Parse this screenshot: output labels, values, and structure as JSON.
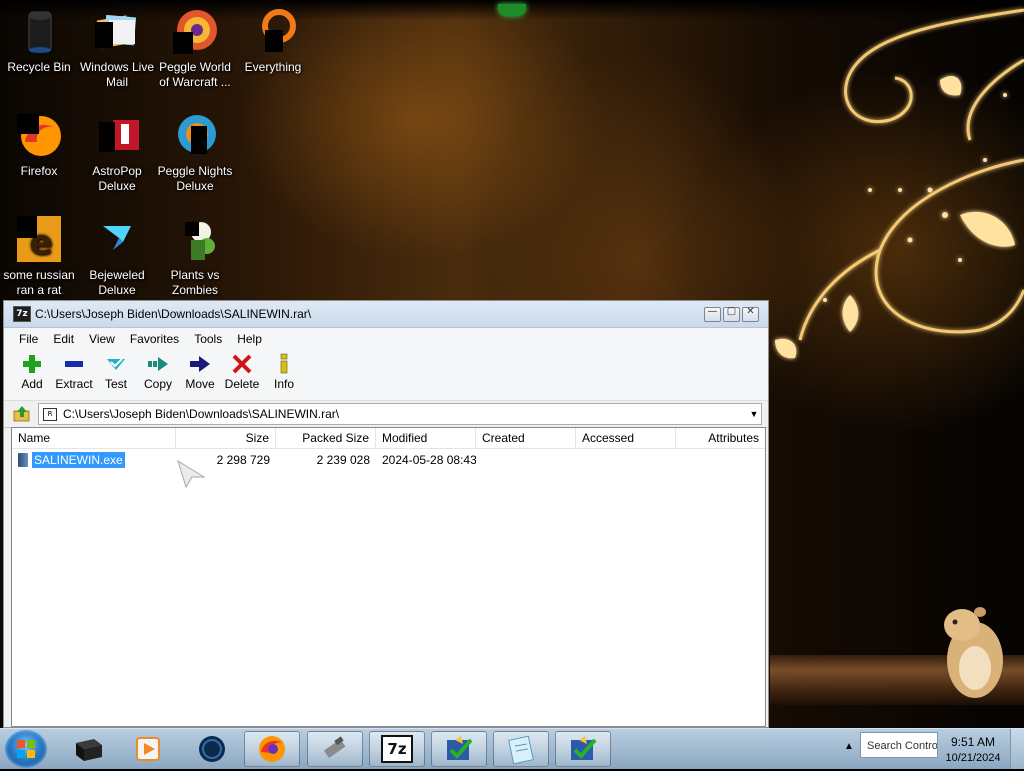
{
  "desktop": {
    "icons": [
      {
        "label": "Recycle Bin",
        "icon": "recycle-bin-icon"
      },
      {
        "label": "Windows Live Mail",
        "icon": "windows-live-mail-icon"
      },
      {
        "label": "Peggle World of Warcraft ...",
        "icon": "peggle-wow-icon"
      },
      {
        "label": "Everything",
        "icon": "everything-search-icon"
      },
      {
        "label": "Firefox",
        "icon": "firefox-icon"
      },
      {
        "label": "AstroPop Deluxe",
        "icon": "astropop-icon"
      },
      {
        "label": "Peggle Nights Deluxe",
        "icon": "peggle-nights-icon"
      },
      {
        "label": "some russian ran a rat",
        "icon": "internet-explorer-shortcut-icon"
      },
      {
        "label": "Bejeweled Deluxe",
        "icon": "bejeweled-icon"
      },
      {
        "label": "Plants vs Zombies",
        "icon": "plants-vs-zombies-icon"
      }
    ]
  },
  "window": {
    "title": "C:\\Users\\Joseph Biden\\Downloads\\SALINEWIN.rar\\",
    "app_icon_text": "7z",
    "controls": {
      "minimize": "—",
      "maximize": "▢",
      "close": "✕"
    },
    "menu": [
      "File",
      "Edit",
      "View",
      "Favorites",
      "Tools",
      "Help"
    ],
    "toolbar": [
      {
        "label": "Add",
        "icon": "add-icon",
        "color": "#1fa31f"
      },
      {
        "label": "Extract",
        "icon": "extract-icon",
        "color": "#1a2bb0"
      },
      {
        "label": "Test",
        "icon": "test-icon",
        "color": "#21b2c8"
      },
      {
        "label": "Copy",
        "icon": "copy-icon",
        "color": "#1b8b7b"
      },
      {
        "label": "Move",
        "icon": "move-icon",
        "color": "#1a1a7a"
      },
      {
        "label": "Delete",
        "icon": "delete-icon",
        "color": "#d21414"
      },
      {
        "label": "Info",
        "icon": "info-icon",
        "color": "#d8c100"
      }
    ],
    "address": "C:\\Users\\Joseph Biden\\Downloads\\SALINEWIN.rar\\",
    "columns": [
      "Name",
      "Size",
      "Packed Size",
      "Modified",
      "Created",
      "Accessed",
      "Attributes"
    ],
    "rows": [
      {
        "name": "SALINEWIN.exe",
        "size": "2 298 729",
        "packed_size": "2 239 028",
        "modified": "2024-05-28 08:43",
        "created": "",
        "accessed": "",
        "attributes": "",
        "selected": true
      }
    ]
  },
  "taskbar": {
    "start_icon": "windows-start-orb-icon",
    "buttons": [
      {
        "icon": "black-box-app-icon"
      },
      {
        "icon": "media-player-icon"
      },
      {
        "icon": "globe-browser-icon"
      },
      {
        "icon": "firefox-icon"
      },
      {
        "icon": "usb-drive-icon"
      },
      {
        "icon": "7zip-icon",
        "text": "7z"
      },
      {
        "icon": "security-check-icon"
      },
      {
        "icon": "notepad-icon"
      },
      {
        "icon": "security-check-icon"
      }
    ],
    "search_placeholder": "Search Control",
    "clock_time": "9:51 AM",
    "clock_date": "10/21/2024"
  },
  "colors": {
    "selection": "#3399ff",
    "titlebar": "#c9d9ec",
    "taskbar": "#a4bdd3"
  }
}
